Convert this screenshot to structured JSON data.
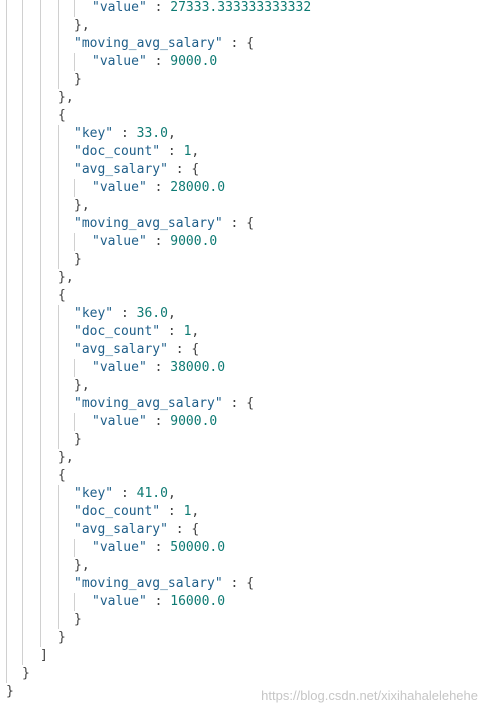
{
  "colors": {
    "key": "#1f5f8a",
    "string": "#1f5f8a",
    "number": "#0e7a73",
    "punct": "#404040",
    "guide": "#d0d0d0"
  },
  "lines": [
    {
      "indent": 5,
      "key": "\"value\"",
      "sep": " : ",
      "val": "27333.333333333332",
      "vt": "number",
      "tail": ""
    },
    {
      "indent": 4,
      "p": "},"
    },
    {
      "indent": 4,
      "key": "\"moving_avg_salary\"",
      "sep": " : ",
      "tail": "{"
    },
    {
      "indent": 5,
      "key": "\"value\"",
      "sep": " : ",
      "val": "9000.0",
      "vt": "number",
      "tail": ""
    },
    {
      "indent": 4,
      "p": "}"
    },
    {
      "indent": 3,
      "p": "},"
    },
    {
      "indent": 3,
      "p": "{"
    },
    {
      "indent": 4,
      "key": "\"key\"",
      "sep": " : ",
      "val": "33.0",
      "vt": "number",
      "tail": ","
    },
    {
      "indent": 4,
      "key": "\"doc_count\"",
      "sep": " : ",
      "val": "1",
      "vt": "number",
      "tail": ","
    },
    {
      "indent": 4,
      "key": "\"avg_salary\"",
      "sep": " : ",
      "tail": "{"
    },
    {
      "indent": 5,
      "key": "\"value\"",
      "sep": " : ",
      "val": "28000.0",
      "vt": "number",
      "tail": ""
    },
    {
      "indent": 4,
      "p": "},"
    },
    {
      "indent": 4,
      "key": "\"moving_avg_salary\"",
      "sep": " : ",
      "tail": "{"
    },
    {
      "indent": 5,
      "key": "\"value\"",
      "sep": " : ",
      "val": "9000.0",
      "vt": "number",
      "tail": ""
    },
    {
      "indent": 4,
      "p": "}"
    },
    {
      "indent": 3,
      "p": "},"
    },
    {
      "indent": 3,
      "p": "{"
    },
    {
      "indent": 4,
      "key": "\"key\"",
      "sep": " : ",
      "val": "36.0",
      "vt": "number",
      "tail": ","
    },
    {
      "indent": 4,
      "key": "\"doc_count\"",
      "sep": " : ",
      "val": "1",
      "vt": "number",
      "tail": ","
    },
    {
      "indent": 4,
      "key": "\"avg_salary\"",
      "sep": " : ",
      "tail": "{"
    },
    {
      "indent": 5,
      "key": "\"value\"",
      "sep": " : ",
      "val": "38000.0",
      "vt": "number",
      "tail": ""
    },
    {
      "indent": 4,
      "p": "},"
    },
    {
      "indent": 4,
      "key": "\"moving_avg_salary\"",
      "sep": " : ",
      "tail": "{"
    },
    {
      "indent": 5,
      "key": "\"value\"",
      "sep": " : ",
      "val": "9000.0",
      "vt": "number",
      "tail": ""
    },
    {
      "indent": 4,
      "p": "}"
    },
    {
      "indent": 3,
      "p": "},"
    },
    {
      "indent": 3,
      "p": "{"
    },
    {
      "indent": 4,
      "key": "\"key\"",
      "sep": " : ",
      "val": "41.0",
      "vt": "number",
      "tail": ","
    },
    {
      "indent": 4,
      "key": "\"doc_count\"",
      "sep": " : ",
      "val": "1",
      "vt": "number",
      "tail": ","
    },
    {
      "indent": 4,
      "key": "\"avg_salary\"",
      "sep": " : ",
      "tail": "{"
    },
    {
      "indent": 5,
      "key": "\"value\"",
      "sep": " : ",
      "val": "50000.0",
      "vt": "number",
      "tail": ""
    },
    {
      "indent": 4,
      "p": "},"
    },
    {
      "indent": 4,
      "key": "\"moving_avg_salary\"",
      "sep": " : ",
      "tail": "{"
    },
    {
      "indent": 5,
      "key": "\"value\"",
      "sep": " : ",
      "val": "16000.0",
      "vt": "number",
      "tail": ""
    },
    {
      "indent": 4,
      "p": "}"
    },
    {
      "indent": 3,
      "p": "}"
    },
    {
      "indent": 2,
      "p": "]"
    },
    {
      "indent": 1,
      "p": "}"
    },
    {
      "indent": 0,
      "p": "}"
    }
  ],
  "watermark": "https://blog.csdn.net/xixihahalelehehe"
}
